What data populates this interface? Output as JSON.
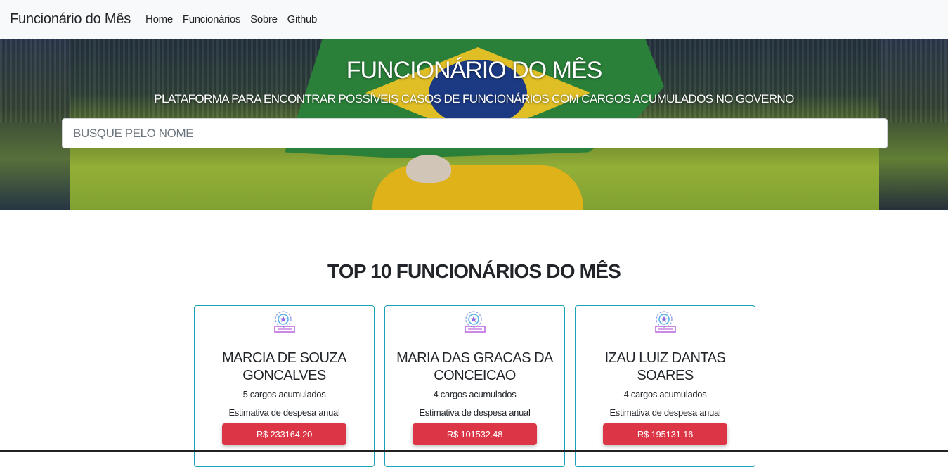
{
  "navbar": {
    "brand": "Funcionário do Mês",
    "links": [
      "Home",
      "Funcionários",
      "Sobre",
      "Github"
    ]
  },
  "hero": {
    "title": "FUNCIONÁRIO DO MÊS",
    "subtitle": "PLATAFORMA PARA ENCONTRAR POSSÍVEIS CASOS DE FUNCIONÁRIOS COM CARGOS ACUMULADOS NO GOVERNO",
    "search_placeholder": "BUSQUE PELO NOME",
    "search_value": ""
  },
  "section": {
    "title": "TOP 10 FUNCIONÁRIOS DO MÊS"
  },
  "cards": [
    {
      "name_line1": "MARCIA DE SOUZA",
      "name_line2": "GONCALVES",
      "count": "5 cargos acumulados",
      "estimate_label": "Estimativa de despesa anual",
      "amount": "R$ 233164.20"
    },
    {
      "name_line1": "MARIA DAS GRACAS DA",
      "name_line2": "CONCEICAO",
      "count": "4 cargos acumulados",
      "estimate_label": "Estimativa de despesa anual",
      "amount": "R$ 101532.48"
    },
    {
      "name_line1": "IZAU LUIZ DANTAS",
      "name_line2": "SOARES",
      "count": "4 cargos acumulados",
      "estimate_label": "Estimativa de despesa anual",
      "amount": "R$ 195131.16"
    }
  ],
  "colors": {
    "card_border": "#17a2b8",
    "button": "#dc3545",
    "navbar": "#f8f9fa"
  },
  "icons": {
    "card_icon": "medal-award-icon"
  }
}
